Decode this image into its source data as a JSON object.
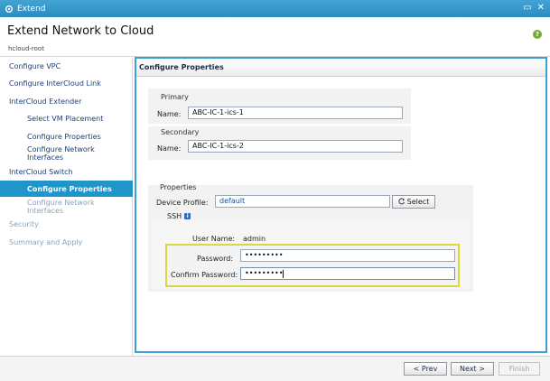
{
  "window": {
    "title": "Extend",
    "minimize_glyph": "▭",
    "close_glyph": "✕"
  },
  "header": {
    "title": "Extend Network to Cloud",
    "subtitle": "hcloud-root",
    "help_glyph": "?"
  },
  "sidebar": {
    "items": [
      {
        "label": "Configure VPC"
      },
      {
        "label": "Configure InterCloud Link"
      },
      {
        "label": "InterCloud Extender"
      },
      {
        "label": "Select VM Placement"
      },
      {
        "label": "Configure Properties"
      },
      {
        "label": "Configure Network Interfaces"
      },
      {
        "label": "InterCloud Switch"
      },
      {
        "label": "Configure Properties"
      },
      {
        "label": "Configure Network Interfaces"
      },
      {
        "label": "Security"
      },
      {
        "label": "Summary and Apply"
      }
    ]
  },
  "main": {
    "section_title": "Configure Properties",
    "primary": {
      "label": "Primary",
      "name_label": "Name:",
      "name_value": "ABC-IC-1-ics-1"
    },
    "secondary": {
      "label": "Secondary",
      "name_label": "Name:",
      "name_value": "ABC-IC-1-ics-2"
    },
    "properties": {
      "label": "Properties",
      "device_profile_label": "Device Profile:",
      "device_profile_value": "default",
      "select_label": "Select",
      "ssh_label": "SSH",
      "ssh_info_glyph": "i",
      "username_label": "User Name:",
      "username_value": "admin",
      "password_label": "Password:",
      "password_value": "•••••••••",
      "confirm_label": "Confirm Password:",
      "confirm_value": "•••••••••"
    }
  },
  "footer": {
    "prev_label": "< Prev",
    "next_label": "Next >",
    "finish_label": "Finish"
  },
  "colors": {
    "accent": "#1f95c9",
    "titlebar": "#2b8cc0",
    "highlight": "#d9d83c"
  }
}
